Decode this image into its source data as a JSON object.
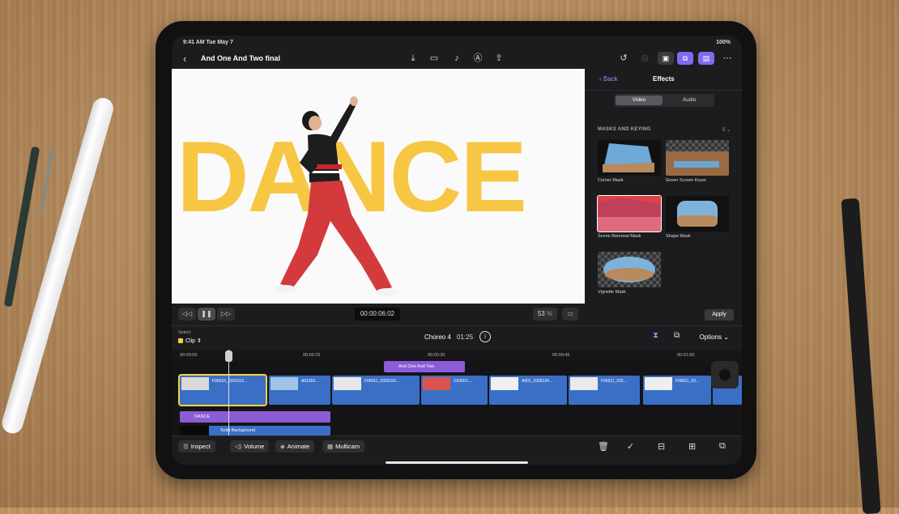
{
  "status": {
    "time_date": "9:41 AM   Tue May 7",
    "battery": "100%"
  },
  "toolbar": {
    "back_icon": "chevron-left-icon",
    "project_title": "And One And Two final",
    "center_icons": [
      "import-icon",
      "camera-icon",
      "microphone-icon",
      "pencil-icon",
      "share-icon"
    ],
    "right_icons": [
      "history-icon",
      "done-icon",
      "photos-icon",
      "effects-icon",
      "inspector-icon",
      "more-icon"
    ]
  },
  "viewer": {
    "title_text": "DANCE",
    "title_color": "#f7c643",
    "controls": {
      "rewind": "◁◁",
      "pause": "❚❚",
      "forward": "▷▷",
      "timecode": "00:00:06:02",
      "zoom": "53",
      "zoom_unit": "%"
    }
  },
  "effects_panel": {
    "back_label": "Back",
    "title": "Effects",
    "tabs": [
      "Video",
      "Audio"
    ],
    "active_tab": "Video",
    "section_title": "MASKS AND KEYING",
    "section_count": "5",
    "items": [
      {
        "label": "Corner Mask"
      },
      {
        "label": "Green Screen Keyer"
      },
      {
        "label": "Scene Removal Mask"
      },
      {
        "label": "Shape Mask"
      },
      {
        "label": "Vignette Mask"
      }
    ],
    "apply_label": "Apply"
  },
  "timeline": {
    "select_label": "Select",
    "select_value": "Clip",
    "project_name": "Choreo 4",
    "duration": "01:25",
    "options_label": "Options",
    "ruler_marks": [
      "00:00:00",
      "00:00:15",
      "00:00:30",
      "00:00:45",
      "00:01:00"
    ],
    "title_clip": "And One And Two",
    "video_clips": [
      "F06010_0326119…",
      "A01002…",
      "F06011_0326153…",
      "C03001…",
      "A001_0328134…",
      "F06011_032…",
      "F06011_03…"
    ],
    "dance_clip": "DANCE",
    "background_clip": "Solid Background"
  },
  "bottom_bar": {
    "inspect": "Inspect",
    "volume": "Volume",
    "animate": "Animate",
    "multicam": "Multicam",
    "right_icons": [
      "trash-icon",
      "checkmark-icon",
      "split-icon",
      "detach-icon",
      "replace-icon"
    ]
  }
}
